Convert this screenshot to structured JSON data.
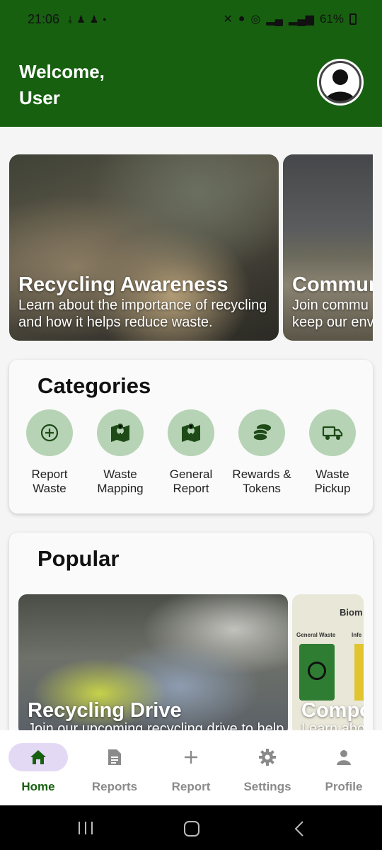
{
  "status_bar": {
    "time": "21:06",
    "battery": "61%"
  },
  "header": {
    "welcome_line1": "Welcome,",
    "welcome_line2": "User"
  },
  "featured": [
    {
      "title": "Recycling Awareness",
      "desc_line1": "Learn about the importance of recycling",
      "desc_line2": "and how it helps reduce waste."
    },
    {
      "title": "Commun",
      "desc_line1": "Join commu",
      "desc_line2": "keep our env"
    }
  ],
  "categories": {
    "title": "Categories",
    "items": [
      {
        "line1": "Report",
        "line2": "Waste",
        "icon": "add-circle-icon"
      },
      {
        "line1": "Waste",
        "line2": "Mapping",
        "icon": "map-pin-icon"
      },
      {
        "line1": "General",
        "line2": "Report",
        "icon": "map-pin-icon"
      },
      {
        "line1": "Rewards &",
        "line2": "Tokens",
        "icon": "coins-icon"
      },
      {
        "line1": "Waste",
        "line2": "Pickup",
        "icon": "truck-icon"
      }
    ]
  },
  "popular": {
    "title": "Popular",
    "items": [
      {
        "title": "Recycling Drive",
        "desc": "Join our upcoming recycling drive to help"
      },
      {
        "title": "Compo",
        "desc": "Learn abo",
        "poster_heading": "Biom",
        "poster_labels": [
          "General Waste",
          "Infe"
        ]
      }
    ]
  },
  "bottom_nav": [
    {
      "label": "Home",
      "icon": "home-icon",
      "active": true
    },
    {
      "label": "Reports",
      "icon": "document-icon",
      "active": false
    },
    {
      "label": "Report",
      "icon": "plus-icon",
      "active": false
    },
    {
      "label": "Settings",
      "icon": "gear-icon",
      "active": false
    },
    {
      "label": "Profile",
      "icon": "person-icon",
      "active": false
    }
  ],
  "colors": {
    "brand_green": "#176010",
    "category_circle": "#b7d3b5",
    "active_pill": "#e3d9f5"
  }
}
